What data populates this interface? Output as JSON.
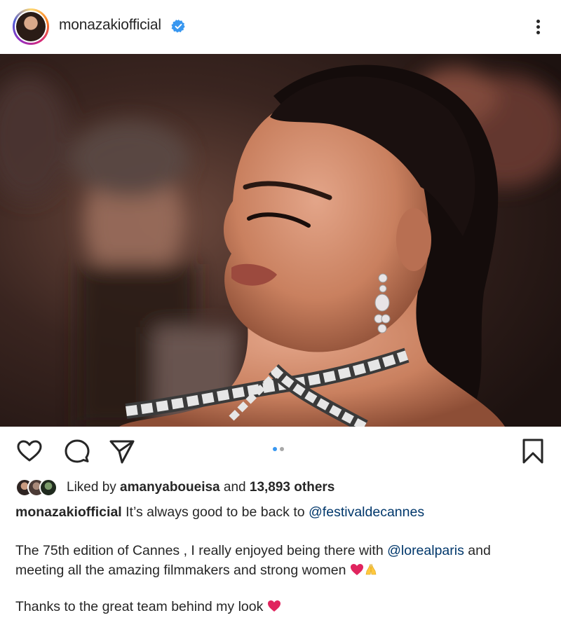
{
  "header": {
    "username": "monazakiofficial",
    "verified": true,
    "more_icon": "more-vertical-icon"
  },
  "post": {
    "carousel_index": 1,
    "carousel_count": 2
  },
  "actions": {
    "like_icon": "heart-icon",
    "comment_icon": "comment-icon",
    "share_icon": "send-icon",
    "save_icon": "bookmark-icon"
  },
  "likes": {
    "prefix": "Liked by ",
    "user": "amanyaboueisa",
    "middle": " and ",
    "others": "13,893 others"
  },
  "caption": {
    "username": "monazakiofficial",
    "line1_text": " It’s always good to be back to ",
    "line1_mention": "@festivaldecannes",
    "para2_a": "The 75th edition of Cannes , I really enjoyed being there with ",
    "para2_mention": "@lorealparis",
    "para2_b": " and",
    "para2_c": "meeting all the amazing filmmakers and strong women ",
    "para3": "Thanks to the great team behind my look "
  },
  "colors": {
    "text": "#262626",
    "mention": "#00376b",
    "verified": "#3897f0",
    "dot_active": "#3897f0",
    "dot_inactive": "#a8a8a8",
    "heart_emoji": "#e0245e"
  }
}
